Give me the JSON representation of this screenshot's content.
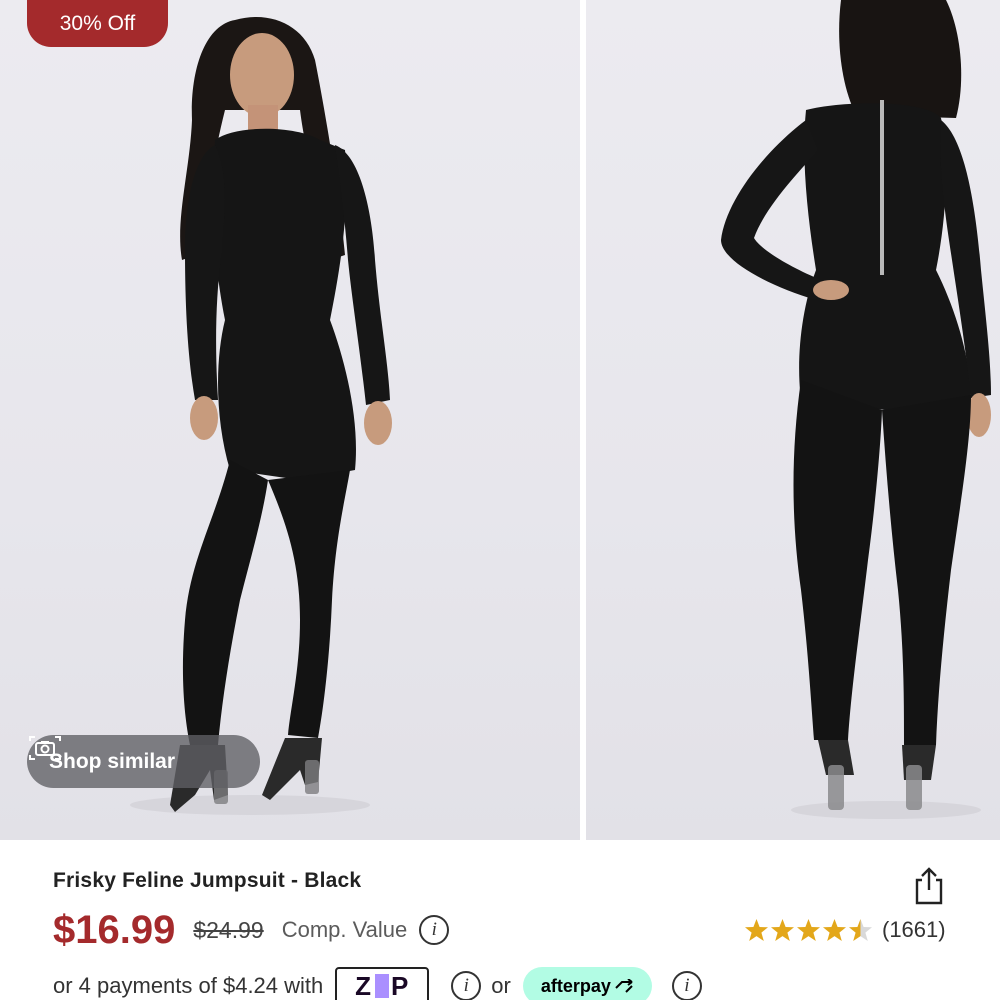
{
  "badge": {
    "discount": "30% Off"
  },
  "gallery": {
    "shop_similar_label": "Shop similar",
    "camera_icon": "camera-icon"
  },
  "product": {
    "title": "Frisky Feline Jumpsuit - Black",
    "price": "$16.99",
    "original_price": "$24.99",
    "comp_value_label": "Comp. Value",
    "rating_value": 4.5,
    "review_count": "(1661)"
  },
  "payments": {
    "text": "or 4 payments of $4.24 with",
    "zip_label": "zip",
    "or_label": "or",
    "afterpay_label": "afterpay"
  },
  "colors": {
    "accent_red": "#a42a2c",
    "star_gold": "#e3a71a",
    "afterpay_mint": "#b2fce4",
    "zip_purple": "#aa8fff"
  }
}
